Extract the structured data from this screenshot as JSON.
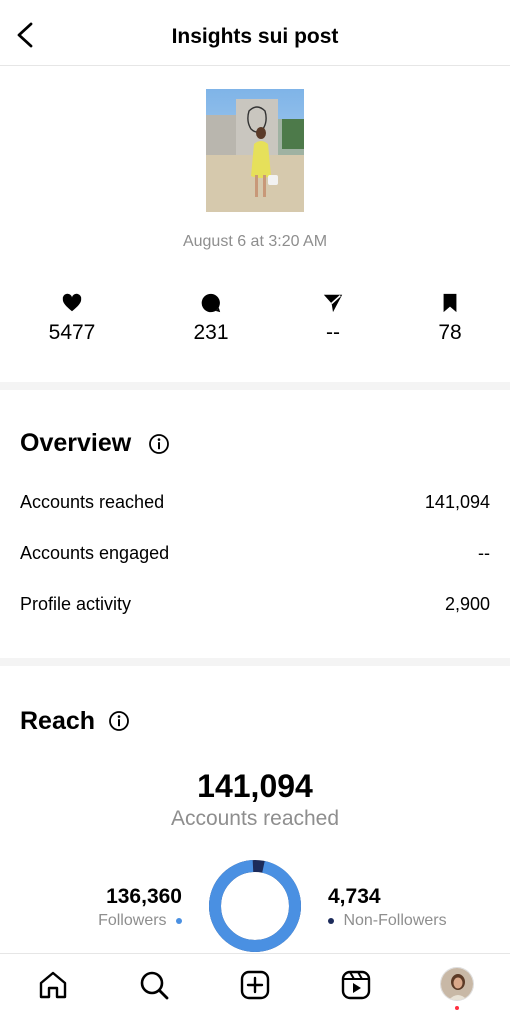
{
  "header": {
    "title": "Insights sui post"
  },
  "post": {
    "date": "August 6 at 3:20 AM"
  },
  "stats": {
    "likes": "5477",
    "comments": "231",
    "shares": "--",
    "saves": "78"
  },
  "overview": {
    "title": "Overview",
    "rows": [
      {
        "label": "Accounts reached",
        "value": "141,094"
      },
      {
        "label": "Accounts engaged",
        "value": "--"
      },
      {
        "label": "Profile activity",
        "value": "2,900"
      }
    ]
  },
  "reach": {
    "title": "Reach",
    "total": "141,094",
    "total_label": "Accounts reached",
    "followers_value": "136,360",
    "followers_label": "Followers",
    "nonfollowers_value": "4,734",
    "nonfollowers_label": "Non-Followers",
    "followers_fraction": 0.966,
    "followers_color": "#4a90e2",
    "nonfollowers_color": "#1c2b5a"
  },
  "tabbar": {
    "icons": [
      "home-icon",
      "search-icon",
      "create-icon",
      "reels-icon",
      "profile-avatar"
    ]
  }
}
